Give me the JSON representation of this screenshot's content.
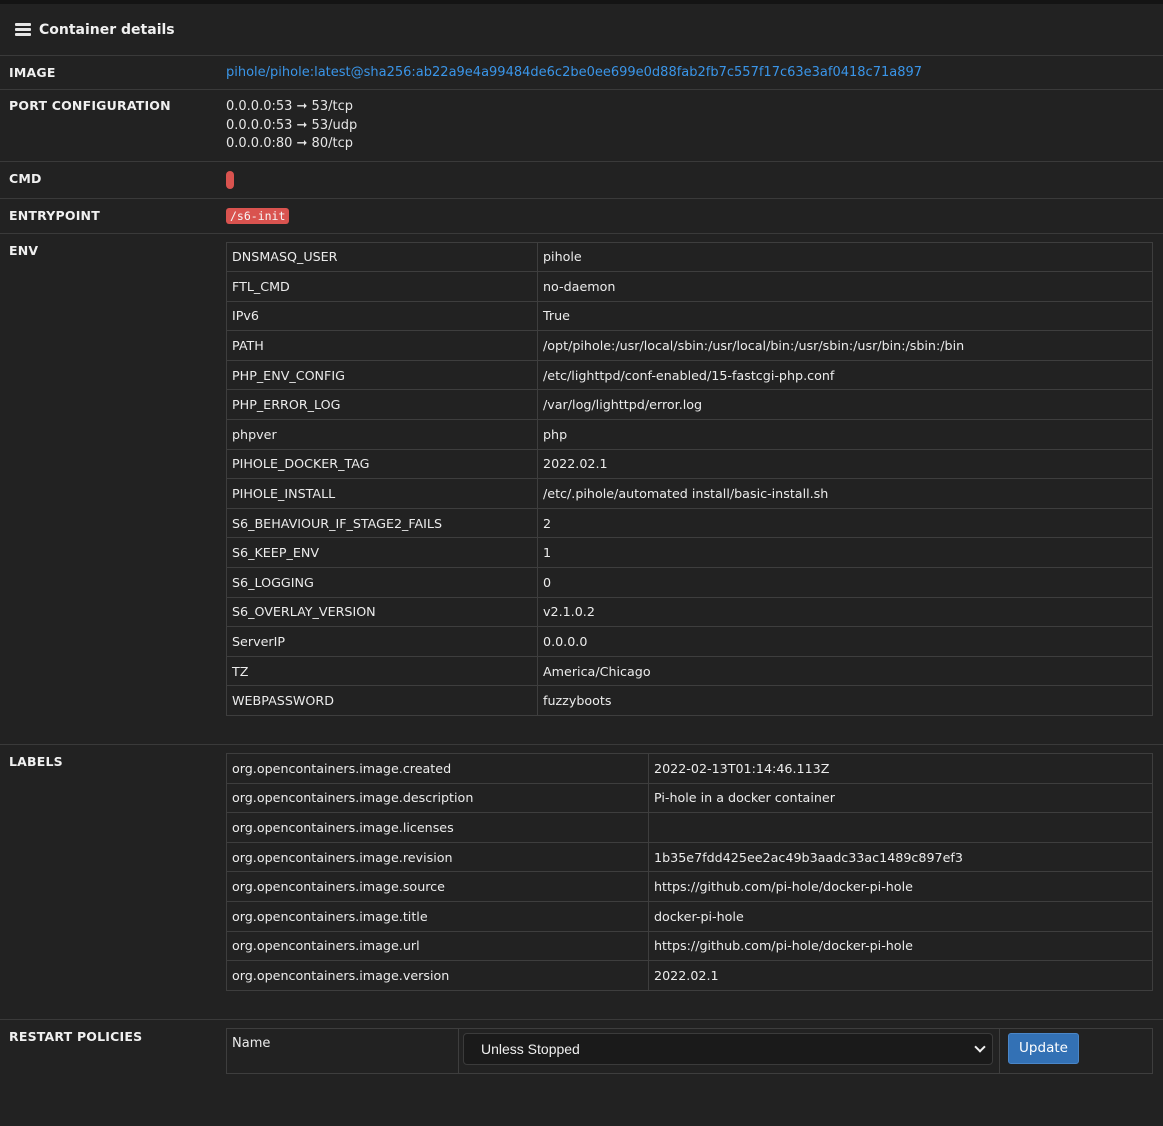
{
  "header": {
    "title": "Container details",
    "icon": "server-list-icon"
  },
  "image": {
    "label": "IMAGE",
    "value": "pihole/pihole:latest@sha256:ab22a9e4a99484de6c2be0ee699e0d88fab2fb7c557f17c63e3af0418c71a897"
  },
  "ports": {
    "label": "PORT CONFIGURATION",
    "items": [
      "0.0.0.0:53 ➞ 53/tcp",
      "0.0.0.0:53 ➞ 53/udp",
      "0.0.0.0:80 ➞ 80/tcp"
    ]
  },
  "cmd": {
    "label": "CMD"
  },
  "entrypoint": {
    "label": "ENTRYPOINT",
    "value": "/s6-init"
  },
  "env": {
    "label": "ENV",
    "rows": [
      {
        "k": "DNSMASQ_USER",
        "v": "pihole"
      },
      {
        "k": "FTL_CMD",
        "v": "no-daemon"
      },
      {
        "k": "IPv6",
        "v": "True"
      },
      {
        "k": "PATH",
        "v": "/opt/pihole:/usr/local/sbin:/usr/local/bin:/usr/sbin:/usr/bin:/sbin:/bin"
      },
      {
        "k": "PHP_ENV_CONFIG",
        "v": "/etc/lighttpd/conf-enabled/15-fastcgi-php.conf"
      },
      {
        "k": "PHP_ERROR_LOG",
        "v": "/var/log/lighttpd/error.log"
      },
      {
        "k": "phpver",
        "v": "php"
      },
      {
        "k": "PIHOLE_DOCKER_TAG",
        "v": "2022.02.1"
      },
      {
        "k": "PIHOLE_INSTALL",
        "v": "/etc/.pihole/automated install/basic-install.sh"
      },
      {
        "k": "S6_BEHAVIOUR_IF_STAGE2_FAILS",
        "v": "2"
      },
      {
        "k": "S6_KEEP_ENV",
        "v": "1"
      },
      {
        "k": "S6_LOGGING",
        "v": "0"
      },
      {
        "k": "S6_OVERLAY_VERSION",
        "v": "v2.1.0.2"
      },
      {
        "k": "ServerIP",
        "v": "0.0.0.0"
      },
      {
        "k": "TZ",
        "v": "America/Chicago"
      },
      {
        "k": "WEBPASSWORD",
        "v": "fuzzyboots"
      }
    ]
  },
  "labels": {
    "label": "LABELS",
    "rows": [
      {
        "k": "org.opencontainers.image.created",
        "v": "2022-02-13T01:14:46.113Z"
      },
      {
        "k": "org.opencontainers.image.description",
        "v": "Pi-hole in a docker container"
      },
      {
        "k": "org.opencontainers.image.licenses",
        "v": ""
      },
      {
        "k": "org.opencontainers.image.revision",
        "v": "1b35e7fdd425ee2ac49b3aadc33ac1489c897ef3"
      },
      {
        "k": "org.opencontainers.image.source",
        "v": "https://github.com/pi-hole/docker-pi-hole"
      },
      {
        "k": "org.opencontainers.image.title",
        "v": "docker-pi-hole"
      },
      {
        "k": "org.opencontainers.image.url",
        "v": "https://github.com/pi-hole/docker-pi-hole"
      },
      {
        "k": "org.opencontainers.image.version",
        "v": "2022.02.1"
      }
    ]
  },
  "restart": {
    "label": "RESTART POLICIES",
    "name_label": "Name",
    "selected": "Unless Stopped",
    "button": "Update"
  },
  "colors": {
    "link": "#3a95e8",
    "danger": "#d9534f",
    "primary": "#3371b5",
    "background": "#222222"
  }
}
